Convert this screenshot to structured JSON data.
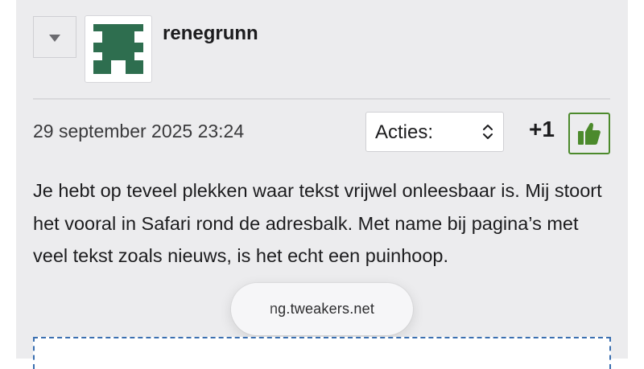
{
  "post": {
    "username": "renegrunn",
    "timestamp": "29 september 2025 23:24",
    "actions_label": "Acties:",
    "score": "+1",
    "body": "Je hebt op teveel plekken waar tekst vrijwel onleesbaar is. Mij stoort het vooral in Safari rond de adresbalk. Met name bij pagina’s met veel tekst zoals nieuws, is het echt een puinhoop."
  },
  "browser": {
    "url": "ng.tweakers.net"
  },
  "icons": {
    "collapse": "chevron-down-icon",
    "actions": "up-down-chevron-icon",
    "like": "thumbs-up-icon",
    "avatar": "identicon-avatar"
  },
  "colors": {
    "panel_bg": "#ececee",
    "avatar_green": "#2e6e4f",
    "like_green": "#4c8a2c",
    "dashed_blue": "#3a6fb0"
  }
}
